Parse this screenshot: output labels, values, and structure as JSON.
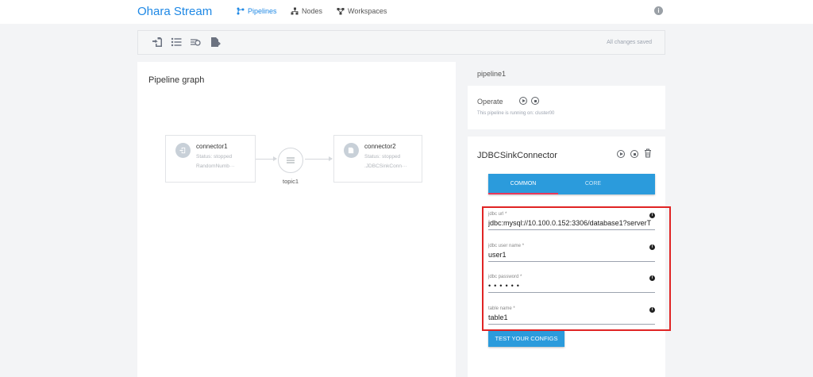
{
  "header": {
    "brand": "Ohara Stream",
    "nav": [
      {
        "label": "Pipelines",
        "icon": "pipeline-icon",
        "active": true
      },
      {
        "label": "Nodes",
        "icon": "nodes-icon",
        "active": false
      },
      {
        "label": "Workspaces",
        "icon": "workspaces-icon",
        "active": false
      }
    ],
    "info_icon": "info-icon"
  },
  "toolbar": {
    "icons": [
      "source-connector-icon",
      "topic-list-icon",
      "stream-app-icon",
      "sink-connector-icon"
    ],
    "status": "All changes saved"
  },
  "graph": {
    "title": "Pipeline graph",
    "nodes": [
      {
        "name": "connector1",
        "status": "Status: stopped",
        "type": "RandomNumb···"
      },
      {
        "name": "connector2",
        "status": "Status: stopped",
        "type": ".JDBCSinkConn···"
      }
    ],
    "topic": {
      "label": "topic1"
    }
  },
  "pipeline": {
    "name": "pipeline1",
    "operate_label": "Operate",
    "running_on": "This pipeline is running on: cluster00"
  },
  "connector": {
    "title": "JDBCSinkConnector",
    "tabs": [
      {
        "label": "COMMON",
        "active": true
      },
      {
        "label": "CORE",
        "active": false
      }
    ],
    "fields": [
      {
        "label": "jdbc url *",
        "value": "jdbc:mysql://10.100.0.152:3306/database1?serverT"
      },
      {
        "label": "jdbc user name *",
        "value": "user1"
      },
      {
        "label": "jdbc password *",
        "value": "••••••"
      },
      {
        "label": "table name *",
        "value": "table1"
      }
    ],
    "test_button": "TEST YOUR CONFIGS"
  },
  "colors": {
    "accent": "#2b9bdc",
    "brand": "#1e88e5",
    "tab_indicator": "#e8375a",
    "highlight": "#e02424"
  }
}
